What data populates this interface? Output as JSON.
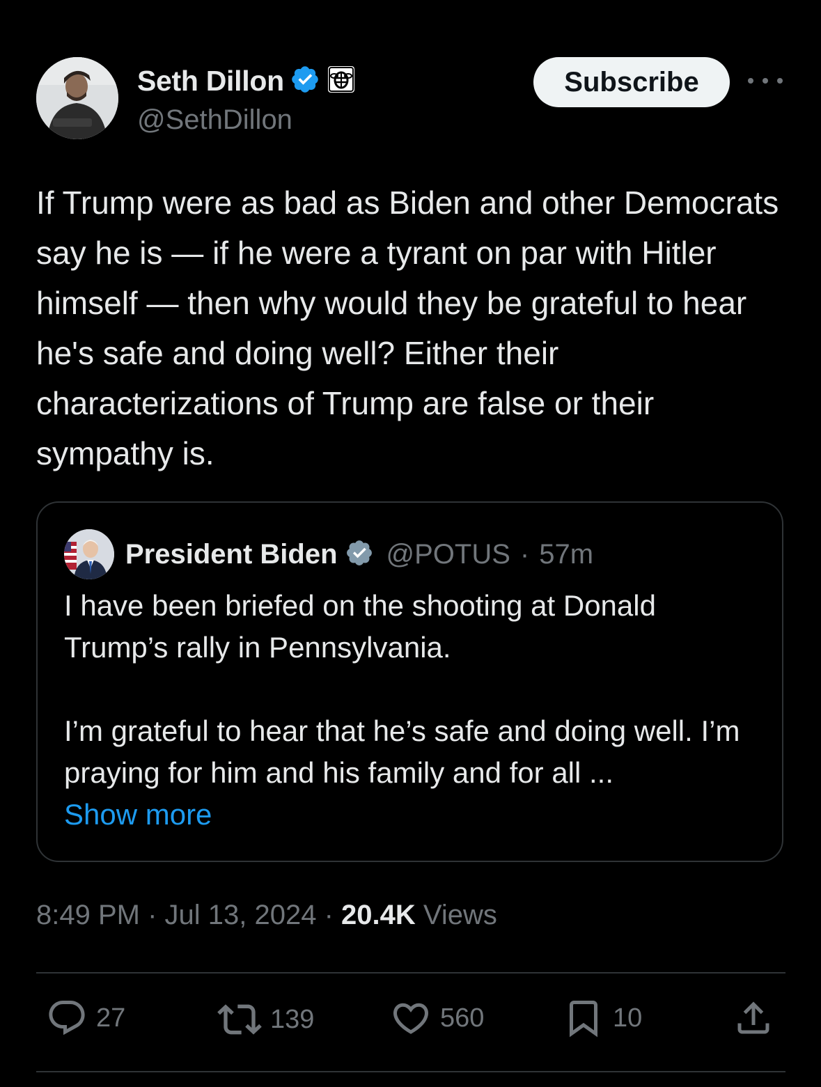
{
  "author": {
    "name": "Seth Dillon",
    "handle": "@SethDillon",
    "verified": true,
    "affiliation_icon": "babylon-bee-badge-icon",
    "subscribe_label": "Subscribe"
  },
  "tweet": {
    "text": "If Trump were as bad as Biden and other Democrats say he is — if he were a tyrant on par with Hitler himself — then why would they be grateful to hear he's safe and doing well? Either their characterizations of Trump are false or their sympathy is."
  },
  "quoted": {
    "name": "President Biden",
    "handle": "@POTUS",
    "separator": "·",
    "time": "57m",
    "paragraph1": "I have been briefed on the shooting at Donald Trump’s rally in Pennsylvania.",
    "paragraph2": "I’m grateful to hear that he’s safe and doing well. I’m praying for him and his family and for all ...",
    "show_more": "Show more"
  },
  "meta": {
    "time": "8:49 PM",
    "sep1": " · ",
    "date": "Jul 13, 2024",
    "sep2": " · ",
    "views_count": "20.4K",
    "views_label": " Views"
  },
  "actions": {
    "replies": "27",
    "reposts": "139",
    "likes": "560",
    "bookmarks": "10"
  },
  "colors": {
    "background": "#000000",
    "text": "#e7e9ea",
    "secondary": "#71767b",
    "link": "#1d9bf0",
    "verified": "#1d9bf0",
    "border": "#2f3336"
  }
}
